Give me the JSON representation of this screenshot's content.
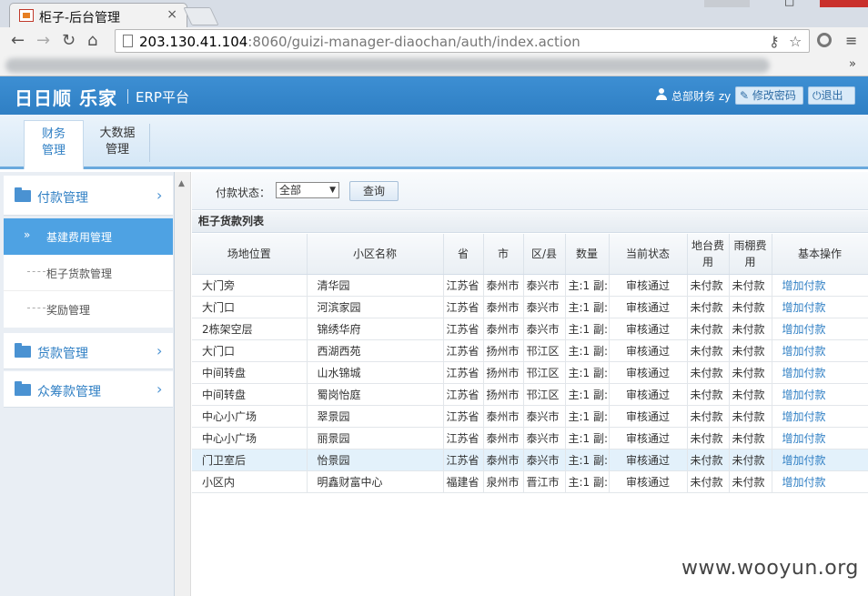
{
  "browser": {
    "tab_title": "柜子-后台管理",
    "tab_close": "×",
    "url_host": "203.130.41.104",
    "url_rest": ":8060/guizi-manager-diaochan/auth/index.action",
    "bookmarks_more": "»"
  },
  "header": {
    "logo": "日日顺 乐家",
    "subtitle": "ERP平台",
    "user": "总部财务 zy",
    "change_password": "修改密码",
    "logout": "退出"
  },
  "modules": [
    {
      "label_line1": "财务",
      "label_line2": "管理"
    },
    {
      "label_line1": "大数据",
      "label_line2": "管理"
    }
  ],
  "sidebar": {
    "groups": [
      {
        "label": "付款管理"
      },
      {
        "label": "货款管理"
      },
      {
        "label": "众筹款管理"
      }
    ],
    "items": [
      {
        "label": "基建费用管理"
      },
      {
        "label": "柜子货款管理"
      },
      {
        "label": "奖励管理"
      }
    ]
  },
  "filter": {
    "label": "付款状态：",
    "selected": "全部",
    "query_button": "查询"
  },
  "list": {
    "title": "柜子货款列表",
    "columns": [
      "场地位置",
      "小区名称",
      "省",
      "市",
      "区/县",
      "数量",
      "当前状态",
      "地台费用",
      "雨棚费用",
      "基本操作"
    ],
    "rows": [
      [
        "大门旁",
        "清华园",
        "江苏省",
        "泰州市",
        "泰兴市",
        "主:1 副:",
        "审核通过",
        "未付款",
        "未付款",
        "增加付款"
      ],
      [
        "大门口",
        "河滨家园",
        "江苏省",
        "泰州市",
        "泰兴市",
        "主:1 副:",
        "审核通过",
        "未付款",
        "未付款",
        "增加付款"
      ],
      [
        "2栋架空层",
        "锦绣华府",
        "江苏省",
        "泰州市",
        "泰兴市",
        "主:1 副:",
        "审核通过",
        "未付款",
        "未付款",
        "增加付款"
      ],
      [
        "大门口",
        "西湖西苑",
        "江苏省",
        "扬州市",
        "邗江区",
        "主:1 副:",
        "审核通过",
        "未付款",
        "未付款",
        "增加付款"
      ],
      [
        "中间转盘",
        "山水锦城",
        "江苏省",
        "扬州市",
        "邗江区",
        "主:1 副:",
        "审核通过",
        "未付款",
        "未付款",
        "增加付款"
      ],
      [
        "中间转盘",
        "蜀岗怡庭",
        "江苏省",
        "扬州市",
        "邗江区",
        "主:1 副:",
        "审核通过",
        "未付款",
        "未付款",
        "增加付款"
      ],
      [
        "中心小广场",
        "翠景园",
        "江苏省",
        "泰州市",
        "泰兴市",
        "主:1 副:",
        "审核通过",
        "未付款",
        "未付款",
        "增加付款"
      ],
      [
        "中心小广场",
        "丽景园",
        "江苏省",
        "泰州市",
        "泰兴市",
        "主:1 副:",
        "审核通过",
        "未付款",
        "未付款",
        "增加付款"
      ],
      [
        "门卫室后",
        "怡景园",
        "江苏省",
        "泰州市",
        "泰兴市",
        "主:1 副:",
        "审核通过",
        "未付款",
        "未付款",
        "增加付款"
      ],
      [
        "小区内",
        "明鑫财富中心",
        "福建省",
        "泉州市",
        "晋江市",
        "主:1 副:",
        "审核通过",
        "未付款",
        "未付款",
        "增加付款"
      ]
    ]
  },
  "watermark": "www.wooyun.org",
  "colors": {
    "accent": "#2f7fc4",
    "header_bg": "#3d8fd3",
    "active_nav": "#4ea2e3",
    "highlight_row": "#e3f1fb"
  }
}
